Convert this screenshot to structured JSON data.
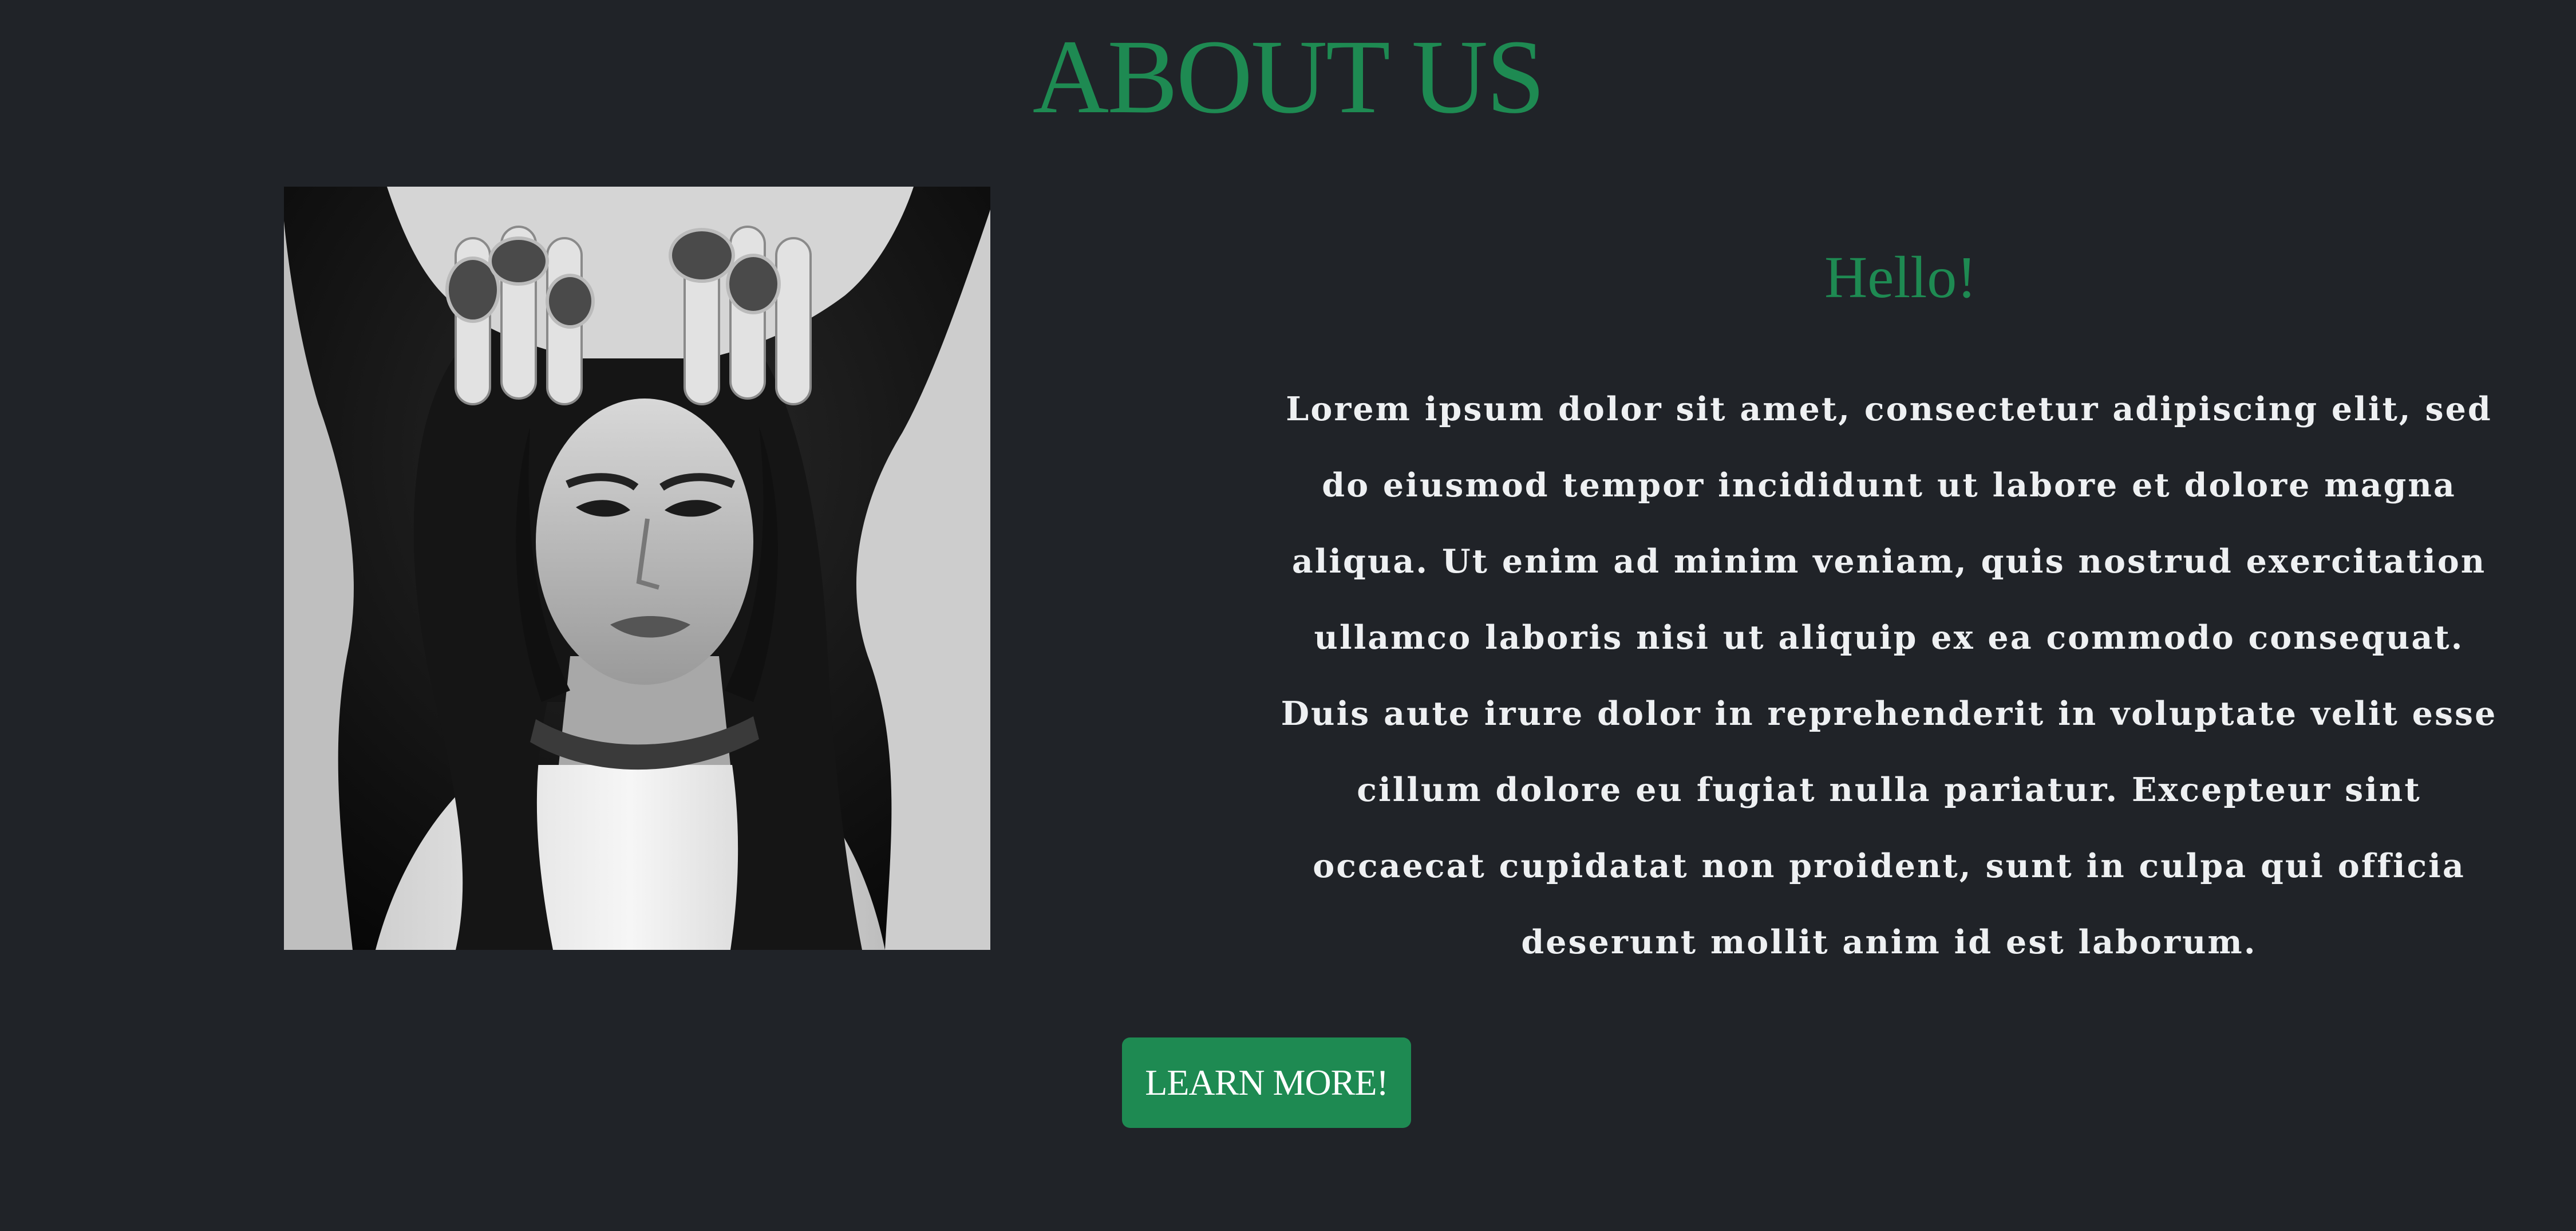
{
  "about": {
    "title": "ABOUT US",
    "heading": "Hello!",
    "paragraph": "Lorem ipsum dolor sit amet, consectetur adipiscing elit, sed do eiusmod tempor incididunt ut labore et dolore magna aliqua. Ut enim ad minim veniam, quis nostrud exercitation ullamco laboris nisi ut aliquip ex ea commodo consequat. Duis aute irure dolor in reprehenderit in voluptate velit esse cillum dolore eu fugiat nulla pariatur. Excepteur sint occaecat cupidatat non proident, sunt in culpa qui officia deserunt mollit anim id est laborum.",
    "button_label": "LEARN MORE!"
  },
  "colors": {
    "background": "#202328",
    "accent": "#1e8a52",
    "text": "#eef0f2"
  }
}
